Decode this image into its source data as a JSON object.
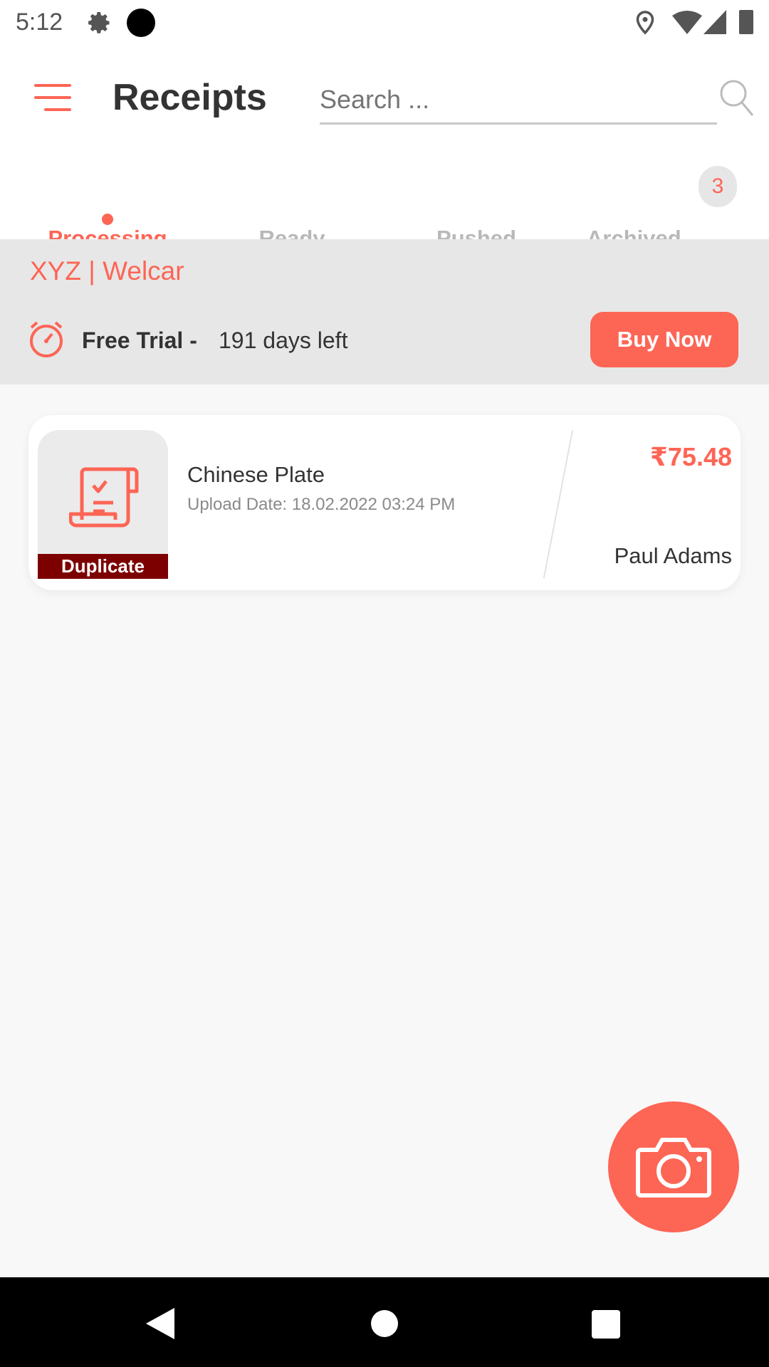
{
  "status_bar": {
    "time": "5:12",
    "icons": [
      "gear-icon",
      "dot-icon",
      "location-icon",
      "wifi-icon",
      "signal-icon",
      "battery-icon"
    ]
  },
  "header": {
    "title": "Receipts",
    "search_placeholder": "Search ...",
    "menu_icon": "hamburger-icon",
    "search_icon": "search-icon"
  },
  "tabs": [
    {
      "label": "Processing",
      "active": true
    },
    {
      "label": "Ready"
    },
    {
      "label": "Pushed"
    },
    {
      "label": "Archived",
      "badge": "3"
    }
  ],
  "banner": {
    "company": "XYZ | Welcar",
    "trial_label": "Free Trial -",
    "days_left": "191 days left",
    "buy_label": "Buy Now"
  },
  "receipts": [
    {
      "title": "Chinese Plate",
      "upload_date": "Upload Date: 18.02.2022 03:24 PM",
      "amount": "₹75.48",
      "user": "Paul Adams",
      "tag": "Duplicate"
    }
  ],
  "colors": {
    "accent": "#fd6555",
    "tag": "#7d0000"
  }
}
